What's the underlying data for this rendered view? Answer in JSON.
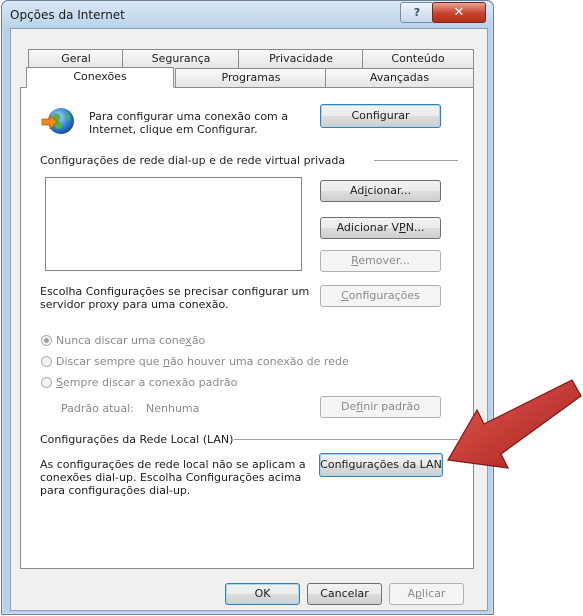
{
  "window": {
    "title": "Opções da Internet"
  },
  "tabs_back": [
    "Geral",
    "Segurança",
    "Privacidade",
    "Conteúdo"
  ],
  "tabs_front": [
    "Conexões",
    "Programas",
    "Avançadas"
  ],
  "setup": {
    "text_line1": "Para configurar uma conexão com a",
    "text_line2": "Internet, clique em Configurar.",
    "button": "Configurar"
  },
  "dialup": {
    "group_label": "Configurações de rede dial-up e de rede virtual privada",
    "add_button": "Adicionar...",
    "add_vpn_button": "Adicionar VPN...",
    "remove_button": "Remover...",
    "settings_hint_line1": "Escolha Configurações se precisar configurar um",
    "settings_hint_line2": "servidor proxy para uma conexão.",
    "settings_button": "Configurações",
    "radio_never": "Nunca discar uma conexão",
    "radio_when_none": "Discar sempre que não houver uma conexão de rede",
    "radio_always": "Sempre discar a conexão padrão",
    "current_default_label": "Padrão atual:",
    "current_default_value": "Nenhuma",
    "set_default_button": "Definir padrão"
  },
  "lan": {
    "group_label": "Configurações da Rede Local (LAN)",
    "text_line1": "As configurações de rede local não se aplicam a",
    "text_line2": "conexões dial-up. Escolha Configurações acima",
    "text_line3": "para configurações dial-up.",
    "button": "Configurações da LAN"
  },
  "footer": {
    "ok": "OK",
    "cancel": "Cancelar",
    "apply": "Aplicar"
  },
  "colors": {
    "arrow": "#c8312e",
    "title_bg": "#bcd3ec",
    "close": "#c8412c"
  }
}
